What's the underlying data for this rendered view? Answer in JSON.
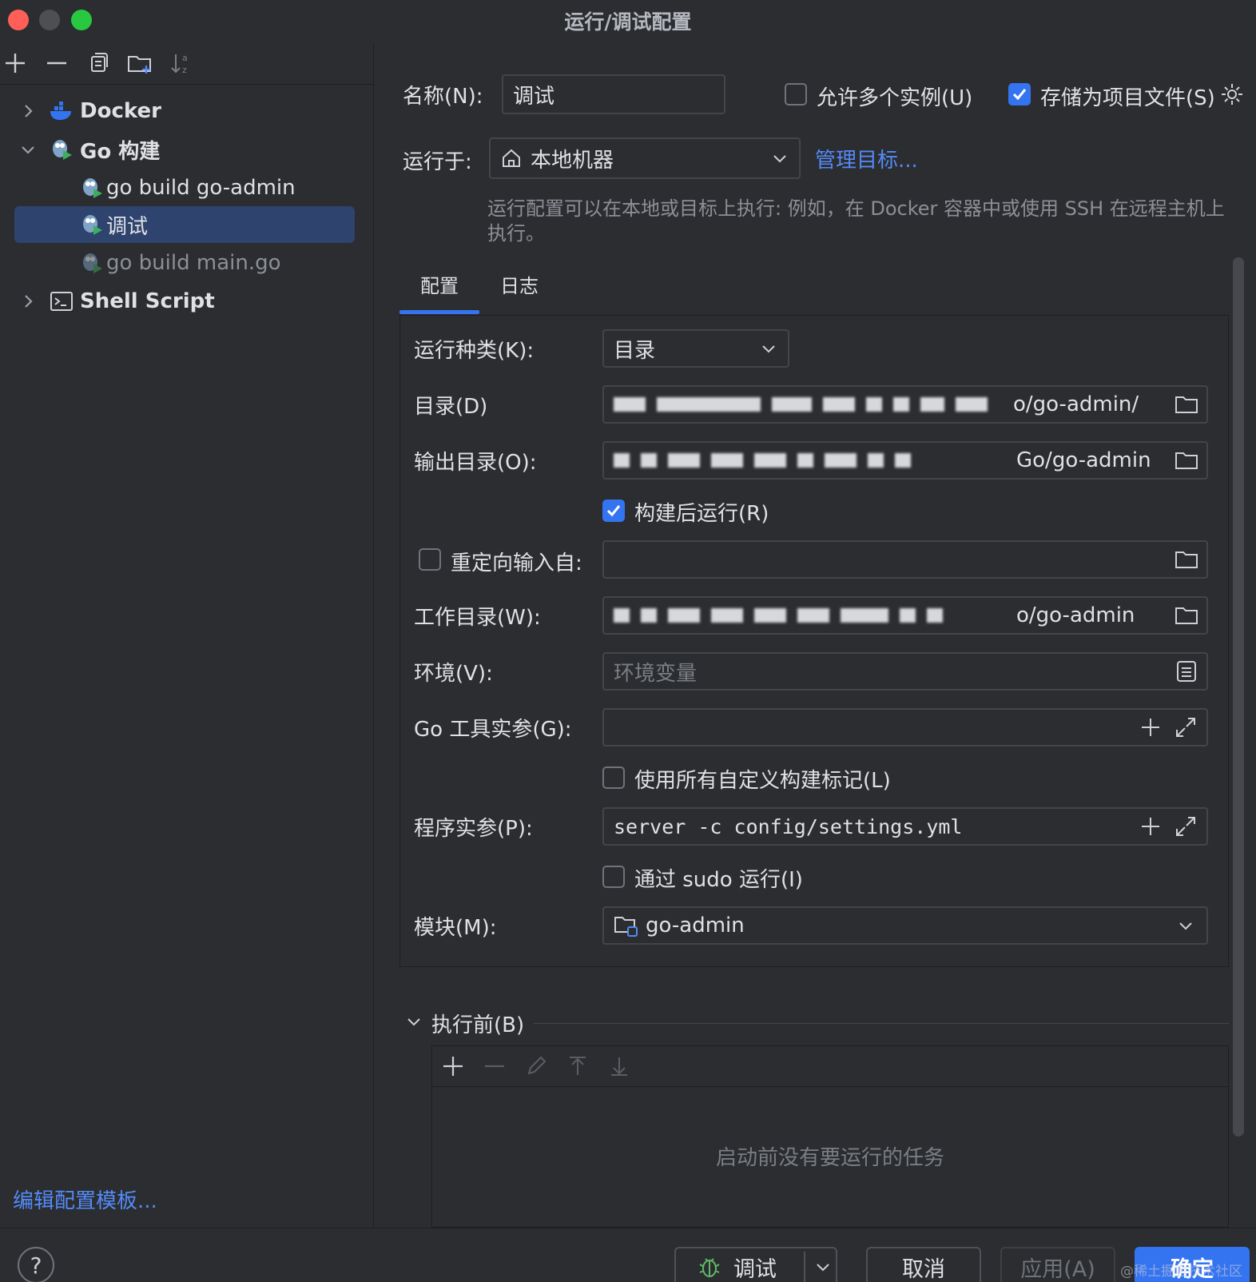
{
  "window": {
    "title": "运行/调试配置",
    "traffic_colors": [
      "#ff5f57",
      "#4e4f52",
      "#28c840"
    ]
  },
  "sidebar": {
    "items": [
      {
        "label": "Docker",
        "bold": true,
        "expanded": false
      },
      {
        "label": "Go 构建",
        "bold": true,
        "expanded": true
      },
      {
        "label": "go build go-admin"
      },
      {
        "label": "调试",
        "selected": true
      },
      {
        "label": "go build main.go",
        "dimmed": true
      },
      {
        "label": "Shell Script",
        "bold": true,
        "expanded": false
      }
    ],
    "edit_templates_link": "编辑配置模板..."
  },
  "header": {
    "name_label": "名称(N):",
    "name_value": "调试",
    "allow_multiple_label": "允许多个实例(U)",
    "allow_multiple_checked": false,
    "store_as_file_label": "存储为项目文件(S)",
    "store_as_file_checked": true,
    "run_on_label": "运行于:",
    "run_on_value": "本地机器",
    "manage_targets_link": "管理目标...",
    "hint": "运行配置可以在本地或目标上执行: 例如，在 Docker 容器中或使用 SSH 在远程主机上执行。"
  },
  "tabs": [
    {
      "label": "配置",
      "active": true
    },
    {
      "label": "日志",
      "active": false
    }
  ],
  "config": {
    "run_kind_label": "运行种类(K):",
    "run_kind_value": "目录",
    "directory_label": "目录(D)",
    "directory_suffix": "o/go-admin/",
    "output_dir_label": "输出目录(O):",
    "output_dir_suffix": "Go/go-admin",
    "run_after_build_label": "构建后运行(R)",
    "run_after_build_checked": true,
    "redirect_input_label": "重定向输入自:",
    "redirect_input_checked": false,
    "working_dir_label": "工作目录(W):",
    "working_dir_suffix": "o/go-admin",
    "env_label": "环境(V):",
    "env_placeholder": "环境变量",
    "go_tool_args_label": "Go 工具实参(G):",
    "go_tool_args_value": "",
    "use_all_tags_label": "使用所有自定义构建标记(L)",
    "use_all_tags_checked": false,
    "program_args_label": "程序实参(P):",
    "program_args_value": "server -c config/settings.yml",
    "sudo_label": "通过 sudo 运行(I)",
    "sudo_checked": false,
    "module_label": "模块(M):",
    "module_value": "go-admin"
  },
  "before_launch": {
    "title": "执行前(B)",
    "empty_text": "启动前没有要运行的任务"
  },
  "footer": {
    "debug_button": "调试",
    "cancel_button": "取消",
    "apply_button": "应用(A)",
    "ok_button": "确定",
    "watermark": "@稀土掘金技术社区"
  },
  "colors": {
    "accent": "#3574f0",
    "link": "#548af7",
    "selection": "#2e436e",
    "background": "#2b2d30"
  }
}
